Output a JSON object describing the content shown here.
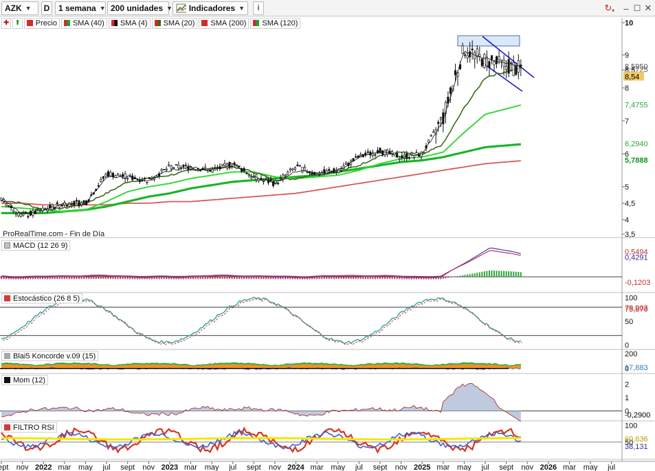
{
  "toolbar": {
    "symbol": "AZK",
    "d_button": "D",
    "period": "1 semana",
    "units": "200 unidades",
    "indicators": "Indicadores"
  },
  "price_panel": {
    "legend": [
      {
        "label": "Precio",
        "color": "#d12b2b"
      },
      {
        "label": "SMA (40)",
        "color": "#17a62b"
      },
      {
        "label": "SMA (4)",
        "color": "#000000"
      },
      {
        "label": "SMA (20)",
        "color": "#3a6b16"
      },
      {
        "label": "SMA (200)",
        "color": "#d12b2b"
      },
      {
        "label": "SMA (120)",
        "color": "#17a62b"
      }
    ],
    "source_label": "ProRealTime.com - Fin de Día",
    "value_tags": [
      {
        "text": "8,5950",
        "color": "#555555",
        "bg": "#ffffff",
        "value": 8.6
      },
      {
        "text": "8,5725",
        "color": "#555555",
        "bg": "#ffffff",
        "value": 8.5
      },
      {
        "text": "8,54",
        "color": "#000000",
        "bg": "#f1c86a",
        "value": 8.3
      },
      {
        "text": "7,4755",
        "color": "#2aa63a",
        "bg": "#ffffff",
        "value": 7.47
      },
      {
        "text": "6,2940",
        "color": "#2aa63a",
        "bg": "#ffffff",
        "value": 6.29
      },
      {
        "text": "5,7888",
        "color": "#0a9a16",
        "bg": "#ffffff",
        "value": 5.79
      }
    ]
  },
  "axis_labels": {
    "price": [
      "10",
      "9",
      "8,5",
      "8",
      "7",
      "6",
      "5",
      "4,5",
      "4",
      "3,5"
    ],
    "macd": [],
    "stoch": [
      "100",
      "50",
      "0"
    ],
    "koncorde": [
      "200",
      "0"
    ],
    "mom": [
      "2",
      "1",
      "0"
    ],
    "rsi": [
      "100",
      "50"
    ],
    "x": [
      {
        "t": "sept",
        "bold": false
      },
      {
        "t": "nov",
        "bold": false
      },
      {
        "t": "2022",
        "bold": true
      },
      {
        "t": "mar",
        "bold": false
      },
      {
        "t": "may",
        "bold": false
      },
      {
        "t": "jul",
        "bold": false
      },
      {
        "t": "sept",
        "bold": false
      },
      {
        "t": "nov",
        "bold": false
      },
      {
        "t": "2023",
        "bold": true
      },
      {
        "t": "mar",
        "bold": false
      },
      {
        "t": "may",
        "bold": false
      },
      {
        "t": "jul",
        "bold": false
      },
      {
        "t": "sept",
        "bold": false
      },
      {
        "t": "nov",
        "bold": false
      },
      {
        "t": "2024",
        "bold": true
      },
      {
        "t": "mar",
        "bold": false
      },
      {
        "t": "may",
        "bold": false
      },
      {
        "t": "jul",
        "bold": false
      },
      {
        "t": "sept",
        "bold": false
      },
      {
        "t": "nov",
        "bold": false
      },
      {
        "t": "2025",
        "bold": true
      },
      {
        "t": "mar",
        "bold": false
      },
      {
        "t": "may",
        "bold": false
      },
      {
        "t": "jul",
        "bold": false
      },
      {
        "t": "sept",
        "bold": false
      },
      {
        "t": "nov",
        "bold": false
      },
      {
        "t": "2026",
        "bold": true
      },
      {
        "t": "mar",
        "bold": false
      },
      {
        "t": "may",
        "bold": false
      },
      {
        "t": "jul",
        "bold": false
      }
    ]
  },
  "panels": {
    "macd": {
      "label": "MACD (12 26 9)",
      "tags": [
        {
          "text": "0,5494",
          "color": "#c03030",
          "value": 0.55
        },
        {
          "text": "0,4291",
          "color": "#3030a0",
          "value": 0.43
        },
        {
          "text": "-0,1203",
          "color": "#c03030",
          "value": -0.12
        }
      ]
    },
    "stoch": {
      "label": "Estocástico (26 8 5)",
      "tags": [
        {
          "text": "79,003",
          "color": "#c03030",
          "value": 79
        },
        {
          "text": "75,876",
          "color": "#c03030",
          "value": 75.9
        }
      ]
    },
    "koncorde": {
      "label": "Blai5 Koncorde v.09 (15)",
      "tags": [
        {
          "text": "17,883",
          "color": "#2f7fc0",
          "value": 17.9
        }
      ]
    },
    "mom": {
      "label": "Mom (12)",
      "tags": [
        {
          "text": "-0,2900",
          "color": "#000000",
          "value": -0.29
        }
      ]
    },
    "rsi": {
      "label": "FILTRO RSI",
      "tags": [
        {
          "text": "60,636",
          "color": "#b0a000",
          "bg": "#f5f0a0",
          "value": 60.6
        },
        {
          "text": "38,131",
          "color": "#3030a0",
          "value": 38.1
        }
      ]
    }
  },
  "chart_data": {
    "type": "line",
    "x": [
      "2021-09",
      "2021-11",
      "2022-01",
      "2022-03",
      "2022-05",
      "2022-07",
      "2022-09",
      "2022-11",
      "2023-01",
      "2023-03",
      "2023-05",
      "2023-07",
      "2023-09",
      "2023-11",
      "2024-01",
      "2024-03",
      "2024-05",
      "2024-07",
      "2024-09",
      "2024-11",
      "2025-01",
      "2025-03",
      "2025-05",
      "2025-07",
      "2025-08"
    ],
    "series": [
      {
        "name": "Precio",
        "values": [
          4.6,
          4.1,
          4.3,
          4.5,
          4.5,
          5.4,
          5.3,
          5.2,
          5.6,
          5.6,
          5.5,
          5.7,
          5.3,
          5.1,
          5.6,
          5.4,
          5.5,
          5.9,
          6.1,
          5.9,
          6.0,
          7.1,
          9.2,
          8.8,
          8.54
        ]
      },
      {
        "name": "SMA (4)",
        "values": [
          4.6,
          4.2,
          4.3,
          4.5,
          4.5,
          5.3,
          5.3,
          5.2,
          5.5,
          5.6,
          5.5,
          5.7,
          5.3,
          5.1,
          5.5,
          5.4,
          5.5,
          5.9,
          6.1,
          5.9,
          6.0,
          7.0,
          9.1,
          8.9,
          8.6
        ]
      },
      {
        "name": "SMA (20)",
        "values": [
          4.6,
          4.5,
          4.3,
          4.35,
          4.5,
          4.8,
          5.15,
          5.25,
          5.35,
          5.5,
          5.55,
          5.6,
          5.45,
          5.2,
          5.25,
          5.4,
          5.45,
          5.65,
          5.95,
          6.05,
          5.95,
          6.3,
          7.4,
          8.3,
          8.57
        ]
      },
      {
        "name": "SMA (40)",
        "values": [
          4.4,
          4.35,
          4.3,
          4.25,
          4.3,
          4.55,
          4.85,
          5.0,
          5.1,
          5.25,
          5.35,
          5.45,
          5.45,
          5.3,
          5.25,
          5.3,
          5.35,
          5.5,
          5.7,
          5.85,
          5.9,
          6.05,
          6.65,
          7.2,
          7.48
        ]
      },
      {
        "name": "SMA (120)",
        "values": [
          4.2,
          4.2,
          4.2,
          4.25,
          4.3,
          4.4,
          4.55,
          4.7,
          4.8,
          4.95,
          5.05,
          5.15,
          5.2,
          5.25,
          5.3,
          5.35,
          5.45,
          5.55,
          5.65,
          5.75,
          5.8,
          5.9,
          6.05,
          6.2,
          6.29
        ]
      },
      {
        "name": "SMA (200)",
        "values": [
          4.5,
          4.5,
          4.45,
          4.45,
          4.45,
          4.45,
          4.5,
          4.5,
          4.55,
          4.55,
          4.6,
          4.65,
          4.7,
          4.75,
          4.8,
          4.9,
          5.0,
          5.1,
          5.2,
          5.3,
          5.4,
          5.5,
          5.6,
          5.7,
          5.79
        ]
      }
    ],
    "y_range": [
      3.3,
      10.2
    ],
    "grid": false,
    "legend": "top-left"
  }
}
